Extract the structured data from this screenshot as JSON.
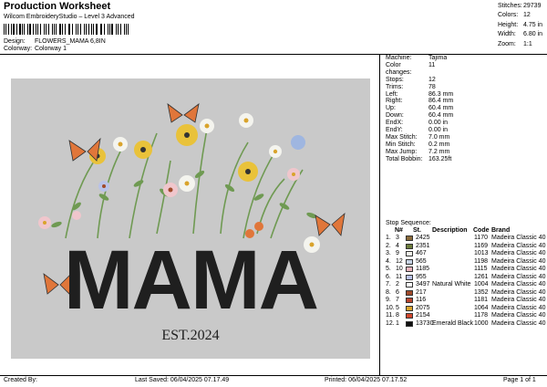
{
  "header": {
    "title": "Production Worksheet",
    "subtitle": "Wilcom EmbroideryStudio – Level 3 Advanced",
    "design_label": "Design:",
    "design_value": "FLOWERS_MAMA 6,8IN",
    "colorway_label": "Colorway:",
    "colorway_value": "Colorway 1"
  },
  "stats": [
    {
      "label": "Stitches:",
      "value": "29739"
    },
    {
      "label": "Colors:",
      "value": "12"
    },
    {
      "label": "Height:",
      "value": "4.75 in"
    },
    {
      "label": "Width:",
      "value": "6.80 in"
    },
    {
      "label": "Zoom:",
      "value": "1:1"
    }
  ],
  "artwork": {
    "word": "MAMA",
    "est_text": "EST.2024",
    "colors": {
      "background": "#c9c9c9",
      "letters": "#1f1f1f",
      "butterfly": "#e0763a",
      "stem": "#6f9a52"
    }
  },
  "specs": [
    {
      "label": "Machine:",
      "value": "Tajima"
    },
    {
      "label": "Color changes:",
      "value": "11"
    },
    {
      "label": "Stops:",
      "value": "12"
    },
    {
      "label": "Trims:",
      "value": "78"
    },
    {
      "label": "Left:",
      "value": "86.3 mm"
    },
    {
      "label": "Right:",
      "value": "86.4 mm"
    },
    {
      "label": "Up:",
      "value": "60.4 mm"
    },
    {
      "label": "Down:",
      "value": "60.4 mm"
    },
    {
      "label": "EndX:",
      "value": "0.00 in"
    },
    {
      "label": "EndY:",
      "value": "0.00 in"
    },
    {
      "label": "Max Stitch:",
      "value": "7.0 mm"
    },
    {
      "label": "Min Stitch:",
      "value": "0.2 mm"
    },
    {
      "label": "Max Jump:",
      "value": "7.2 mm"
    },
    {
      "label": "Total Bobbin:",
      "value": "163.25ft"
    }
  ],
  "sequence": {
    "title": "Stop Sequence:",
    "headers": {
      "n": "N#",
      "st": "St.",
      "desc": "Description",
      "code": "Code",
      "brand": "Brand"
    },
    "rows": [
      {
        "stop": "1.",
        "n": "3",
        "color": "#8a6a3a",
        "st": "2425",
        "desc": "",
        "code": "1170",
        "brand": "Madeira Classic 40"
      },
      {
        "stop": "2.",
        "n": "4",
        "color": "#6c7d3c",
        "st": "2351",
        "desc": "",
        "code": "1169",
        "brand": "Madeira Classic 40"
      },
      {
        "stop": "3.",
        "n": "9",
        "color": "#f2f2ea",
        "st": "467",
        "desc": "",
        "code": "1013",
        "brand": "Madeira Classic 40"
      },
      {
        "stop": "4.",
        "n": "12",
        "color": "#c8d4e6",
        "st": "565",
        "desc": "",
        "code": "1198",
        "brand": "Madeira Classic 40"
      },
      {
        "stop": "5.",
        "n": "10",
        "color": "#e8b4bd",
        "st": "1185",
        "desc": "",
        "code": "1115",
        "brand": "Madeira Classic 40"
      },
      {
        "stop": "6.",
        "n": "11",
        "color": "#b9c2e8",
        "st": "955",
        "desc": "",
        "code": "1261",
        "brand": "Madeira Classic 40"
      },
      {
        "stop": "7.",
        "n": "2",
        "color": "#ffffff",
        "st": "3497",
        "desc": "Natural White",
        "code": "1004",
        "brand": "Madeira Classic 40"
      },
      {
        "stop": "8.",
        "n": "6",
        "color": "#a04a2a",
        "st": "217",
        "desc": "",
        "code": "1352",
        "brand": "Madeira Classic 40"
      },
      {
        "stop": "9.",
        "n": "7",
        "color": "#b9442e",
        "st": "116",
        "desc": "",
        "code": "1181",
        "brand": "Madeira Classic 40"
      },
      {
        "stop": "10.",
        "n": "5",
        "color": "#d9a32b",
        "st": "2075",
        "desc": "",
        "code": "1064",
        "brand": "Madeira Classic 40"
      },
      {
        "stop": "11.",
        "n": "8",
        "color": "#d2472e",
        "st": "2154",
        "desc": "",
        "code": "1178",
        "brand": "Madeira Classic 40"
      },
      {
        "stop": "12.",
        "n": "1",
        "color": "#111111",
        "st": "13730",
        "desc": "Emerald Black",
        "code": "1000",
        "brand": "Madeira Classic 40"
      }
    ]
  },
  "footer": {
    "created_by": "Created By:",
    "last_saved": "Last Saved: 06/04/2025 07.17.49",
    "printed": "Printed: 06/04/2025 07.17.52",
    "page": "Page 1 of 1"
  }
}
